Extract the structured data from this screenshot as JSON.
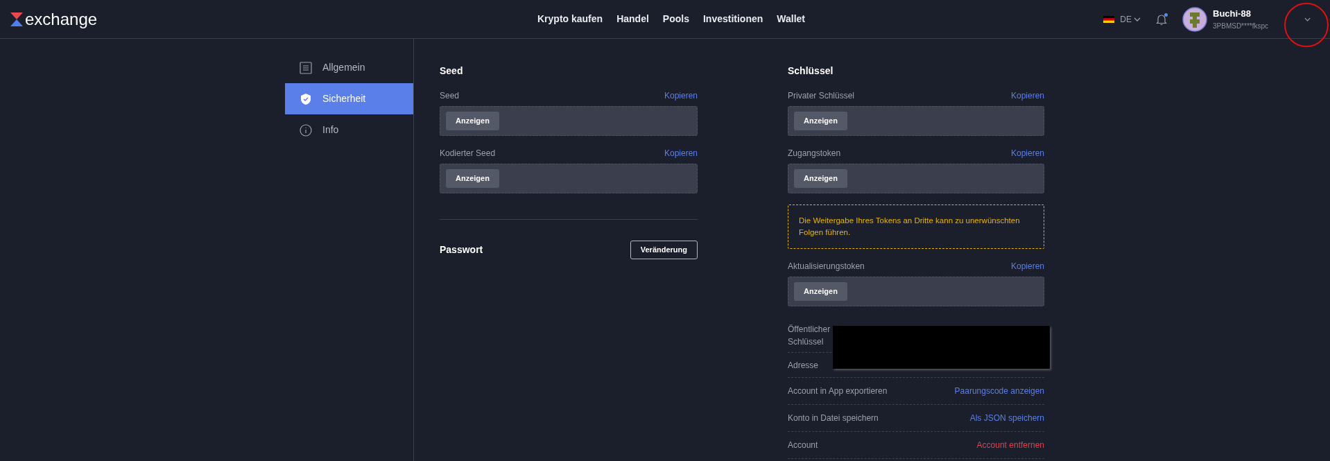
{
  "header": {
    "logo": "exchange",
    "nav": [
      {
        "label": "Krypto kaufen"
      },
      {
        "label": "Handel"
      },
      {
        "label": "Pools"
      },
      {
        "label": "Investitionen"
      },
      {
        "label": "Wallet"
      }
    ],
    "language": "DE",
    "notification_unread": true,
    "user": {
      "name": "Buchi-88",
      "address": "3PBMSD****fkspc"
    }
  },
  "sidebar": {
    "items": [
      {
        "label": "Allgemein",
        "selected": false
      },
      {
        "label": "Sicherheit",
        "selected": true
      },
      {
        "label": "Info",
        "selected": false
      }
    ]
  },
  "seed": {
    "title": "Seed",
    "fields": [
      {
        "label": "Seed",
        "copy": "Kopieren",
        "button": "Anzeigen"
      },
      {
        "label": "Kodierter Seed",
        "copy": "Kopieren",
        "button": "Anzeigen"
      }
    ],
    "password": {
      "label": "Passwort",
      "button": "Veränderung"
    }
  },
  "keys": {
    "title": "Schlüssel",
    "items": [
      {
        "kind": "secret",
        "label": "Privater Schlüssel",
        "copy": "Kopieren",
        "button": "Anzeigen"
      },
      {
        "kind": "secret",
        "label": "Zugangstoken",
        "copy": "Kopieren",
        "button": "Anzeigen"
      },
      {
        "kind": "warning",
        "text": "Die Weitergabe Ihres Tokens an Dritte kann zu unerwünschten Folgen führen."
      },
      {
        "kind": "secret",
        "label": "Aktualisierungstoken",
        "copy": "Kopieren",
        "button": "Anzeigen"
      }
    ],
    "rows": [
      {
        "kind": "redacted",
        "label": "Öffentlicher Schlüssel"
      },
      {
        "kind": "redacted",
        "label": "Adresse"
      },
      {
        "kind": "link",
        "label": "Account in App exportieren",
        "action": "Paarungscode anzeigen"
      },
      {
        "kind": "link",
        "label": "Konto in Datei speichern",
        "action": "Als JSON speichern"
      },
      {
        "kind": "danger",
        "label": "Account",
        "action": "Account entfernen"
      }
    ]
  }
}
